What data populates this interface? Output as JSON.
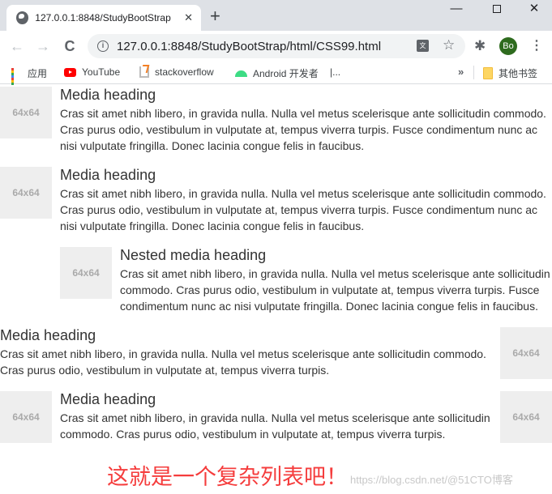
{
  "browser": {
    "tab_title": "127.0.0.1:8848/StudyBootStrap",
    "tab_close": "✕",
    "new_tab": "+",
    "window_controls": {
      "minimize": "—",
      "close": "✕"
    },
    "nav": {
      "back": "←",
      "forward": "→",
      "reload": "C"
    },
    "url": "127.0.0.1:8848/StudyBootStrap/html/CSS99.html",
    "info_icon": "i",
    "translate_icon": "文",
    "star_icon": "☆",
    "extensions_icon": "✱",
    "profile_initials": "Bo",
    "menu_icon": "⋮",
    "bookmarks": [
      {
        "label": "应用",
        "icon": "apps-icon"
      },
      {
        "label": "YouTube",
        "icon": "youtube-icon"
      },
      {
        "label": "stackoverflow",
        "icon": "stackoverflow-icon"
      },
      {
        "label": "Android 开发者",
        "icon": "android-icon"
      },
      {
        "label": "|...",
        "icon": ""
      }
    ],
    "bookmarks_overflow": "»",
    "other_bookmarks": "其他书签"
  },
  "page": {
    "placeholder_label": "64x64",
    "media_items": [
      {
        "heading": "Media heading",
        "body": "Cras sit amet nibh libero, in gravida nulla. Nulla vel metus scelerisque ante sollicitudin commodo. Cras purus odio, vestibulum in vulputate at, tempus viverra turpis. Fusce condimentum nunc ac nisi vulputate fringilla. Donec lacinia congue felis in faucibus."
      },
      {
        "heading": "Media heading",
        "body": "Cras sit amet nibh libero, in gravida nulla. Nulla vel metus scelerisque ante sollicitudin commodo. Cras purus odio, vestibulum in vulputate at, tempus viverra turpis. Fusce condimentum nunc ac nisi vulputate fringilla. Donec lacinia congue felis in faucibus.",
        "nested": {
          "heading": "Nested media heading",
          "body": "Cras sit amet nibh libero, in gravida nulla. Nulla vel metus scelerisque ante sollicitudin commodo. Cras purus odio, vestibulum in vulputate at, tempus viverra turpis. Fusce condimentum nunc ac nisi vulputate fringilla. Donec lacinia congue felis in faucibus."
        }
      },
      {
        "heading": "Media heading",
        "body": "Cras sit amet nibh libero, in gravida nulla. Nulla vel metus scelerisque ante sollicitudin commodo. Cras purus odio, vestibulum in vulputate at, tempus viverra turpis."
      },
      {
        "heading": "Media heading",
        "body": "Cras sit amet nibh libero, in gravida nulla. Nulla vel metus scelerisque ante sollicitudin commodo. Cras purus odio, vestibulum in vulputate at, tempus viverra turpis."
      }
    ],
    "caption": "这就是一个复杂列表吧！",
    "watermark": "https://blog.csdn.net/@51CTO博客"
  },
  "colors": {
    "caption": "#f53d3d",
    "placeholder_bg": "#eeeeee",
    "placeholder_text": "#aaaaaa",
    "profile_bg": "#2e6b1e"
  }
}
